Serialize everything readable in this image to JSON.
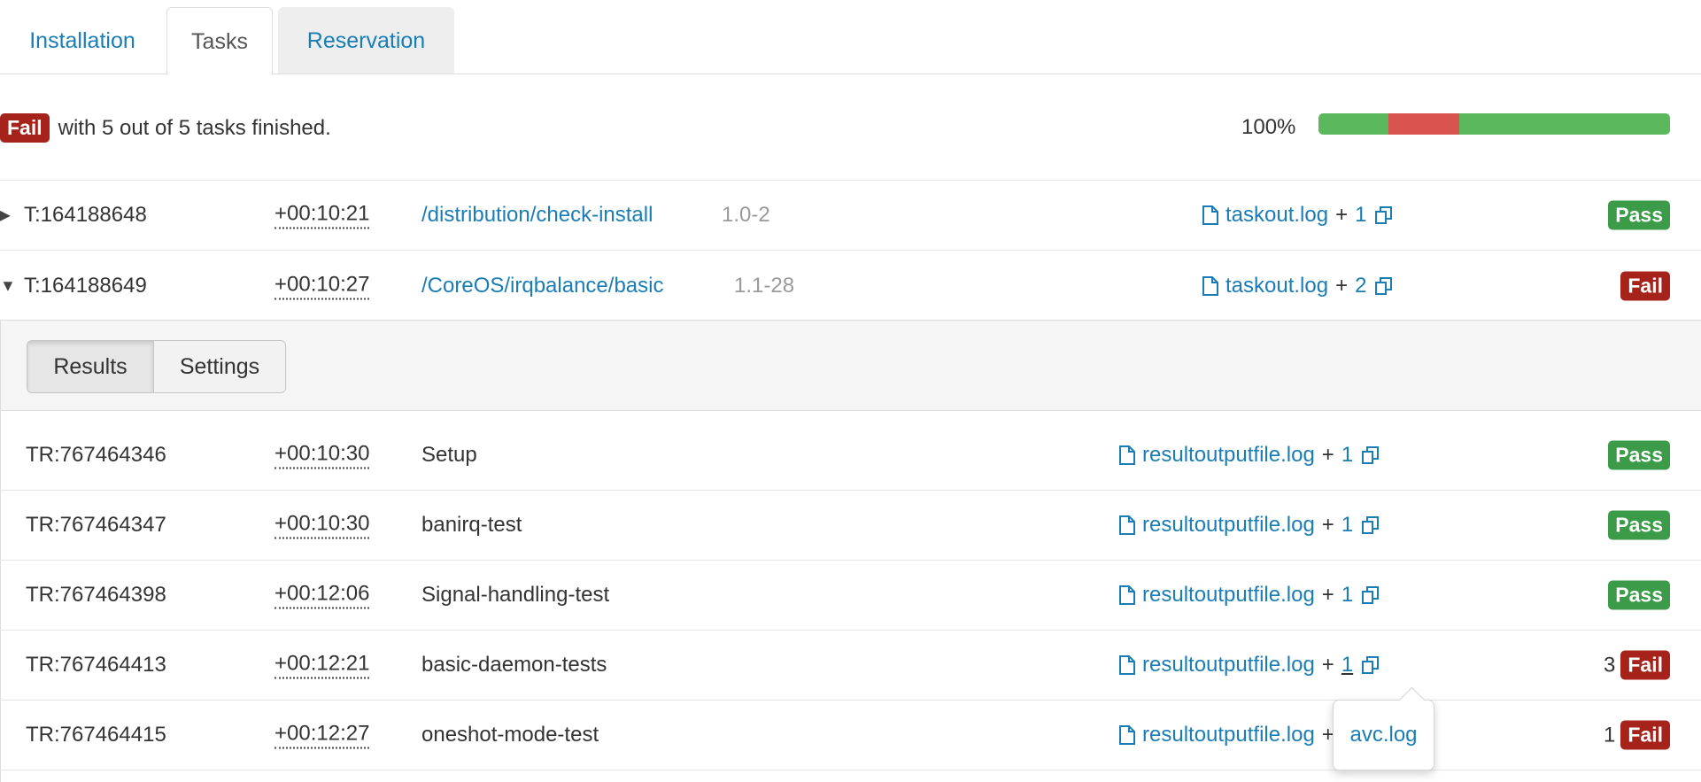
{
  "tabs": {
    "installation": "Installation",
    "tasks": "Tasks",
    "reservation": "Reservation"
  },
  "summary": {
    "status": "Fail",
    "text": "with 5 out of 5 tasks finished.",
    "percent_label": "100%",
    "progress_segments": [
      {
        "status": "pass",
        "percent": 20,
        "color": "#5cb85c"
      },
      {
        "status": "fail",
        "percent": 20,
        "color": "#d9534f"
      },
      {
        "status": "pass",
        "percent": 60,
        "color": "#5cb85c"
      }
    ]
  },
  "tasks": [
    {
      "id": "T:164188648",
      "time": "+00:10:21",
      "name": "/distribution/check-install",
      "version": "1.0-2",
      "file": "taskout.log",
      "plus": "+",
      "more": "1",
      "status": "Pass",
      "expanded": false
    },
    {
      "id": "T:164188649",
      "time": "+00:10:27",
      "name": "/CoreOS/irqbalance/basic",
      "version": "1.1-28",
      "file": "taskout.log",
      "plus": "+",
      "more": "2",
      "status": "Fail",
      "expanded": true
    }
  ],
  "subtabs": {
    "results": "Results",
    "settings": "Settings"
  },
  "results": [
    {
      "id": "TR:767464346",
      "time": "+00:10:30",
      "name": "Setup",
      "file": "resultoutputfile.log",
      "plus": "+",
      "more": "1",
      "count": "",
      "status": "Pass"
    },
    {
      "id": "TR:767464347",
      "time": "+00:10:30",
      "name": "banirq-test",
      "file": "resultoutputfile.log",
      "plus": "+",
      "more": "1",
      "count": "",
      "status": "Pass"
    },
    {
      "id": "TR:767464398",
      "time": "+00:12:06",
      "name": "Signal-handling-test",
      "file": "resultoutputfile.log",
      "plus": "+",
      "more": "1",
      "count": "",
      "status": "Pass"
    },
    {
      "id": "TR:767464413",
      "time": "+00:12:21",
      "name": "basic-daemon-tests",
      "file": "resultoutputfile.log",
      "plus": "+",
      "more": "1",
      "count": "3",
      "status": "Fail"
    },
    {
      "id": "TR:767464415",
      "time": "+00:12:27",
      "name": "oneshot-mode-test",
      "file": "resultoutputfile.log",
      "plus": "+",
      "more": "1",
      "count": "1",
      "status": "Fail"
    }
  ],
  "popover": {
    "file": "avc.log"
  },
  "icons": {
    "file": "file-icon",
    "copy": "copy-icon",
    "collapsed": "caret-right-icon",
    "expanded": "caret-down-icon"
  }
}
